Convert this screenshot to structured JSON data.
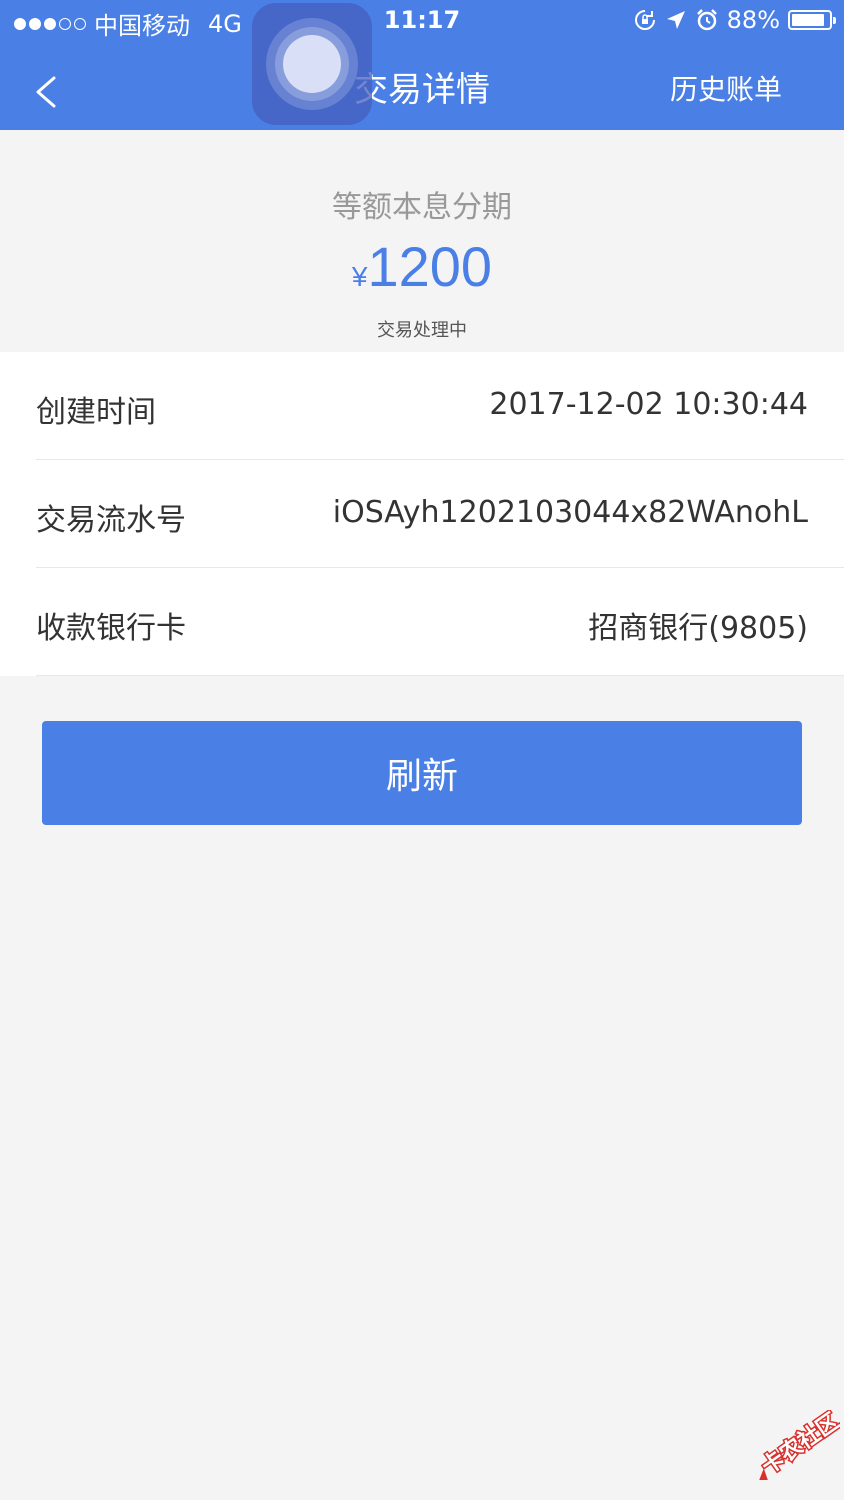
{
  "status_bar": {
    "carrier": "中国移动",
    "network": "4G",
    "time": "11:17",
    "battery": "88%",
    "battery_level": 0.88
  },
  "nav": {
    "title": "交易详情",
    "history_label": "历史账单"
  },
  "summary": {
    "plan": "等额本息分期",
    "currency": "¥",
    "amount": "1200",
    "status": "交易处理中"
  },
  "details": [
    {
      "label": "创建时间",
      "value": "2017-12-02 10:30:44"
    },
    {
      "label": "交易流水号",
      "value": "iOSAyh1202103044x82WAnohL"
    },
    {
      "label": "收款银行卡",
      "value": "招商银行(9805)"
    }
  ],
  "actions": {
    "refresh_label": "刷新"
  },
  "watermark": {
    "text": "卡农社区"
  },
  "colors": {
    "primary": "#4a7fe6",
    "background": "#f4f4f4"
  }
}
